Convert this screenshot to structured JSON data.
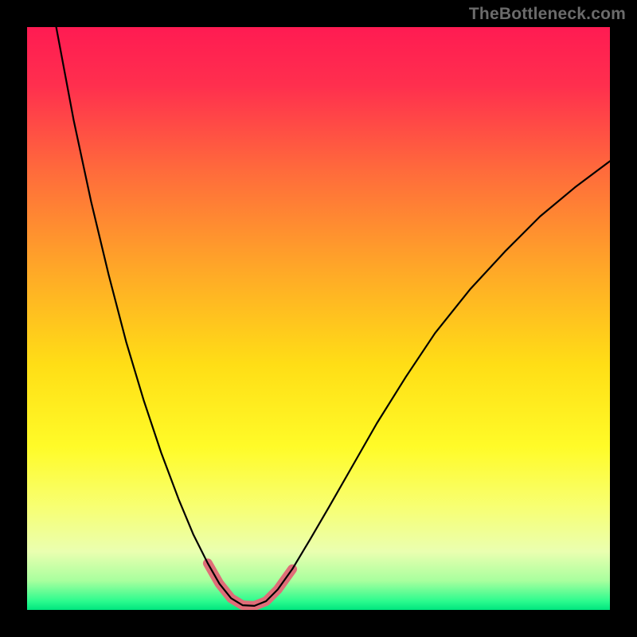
{
  "watermark": "TheBottleneck.com",
  "chart_data": {
    "type": "line",
    "title": "",
    "xlabel": "",
    "ylabel": "",
    "xlim": [
      0,
      100
    ],
    "ylim": [
      0,
      100
    ],
    "grid": false,
    "legend": false,
    "background_gradient": {
      "stops": [
        {
          "offset": 0.0,
          "color": "#ff1b52"
        },
        {
          "offset": 0.1,
          "color": "#ff2f4e"
        },
        {
          "offset": 0.25,
          "color": "#ff6c3b"
        },
        {
          "offset": 0.42,
          "color": "#ffa927"
        },
        {
          "offset": 0.58,
          "color": "#ffde16"
        },
        {
          "offset": 0.72,
          "color": "#fffb28"
        },
        {
          "offset": 0.82,
          "color": "#f8ff70"
        },
        {
          "offset": 0.9,
          "color": "#eaffb0"
        },
        {
          "offset": 0.95,
          "color": "#a8ff9e"
        },
        {
          "offset": 0.985,
          "color": "#2cfb8e"
        },
        {
          "offset": 1.0,
          "color": "#00e57e"
        }
      ]
    },
    "series": [
      {
        "name": "bottleneck-curve",
        "color": "#000000",
        "width": 2.2,
        "points": [
          {
            "x": 5.0,
            "y": 100.0
          },
          {
            "x": 8.0,
            "y": 84.0
          },
          {
            "x": 11.0,
            "y": 70.0
          },
          {
            "x": 14.0,
            "y": 57.5
          },
          {
            "x": 17.0,
            "y": 46.0
          },
          {
            "x": 20.0,
            "y": 36.0
          },
          {
            "x": 23.0,
            "y": 27.0
          },
          {
            "x": 26.0,
            "y": 19.0
          },
          {
            "x": 28.5,
            "y": 13.0
          },
          {
            "x": 31.0,
            "y": 8.0
          },
          {
            "x": 33.0,
            "y": 4.5
          },
          {
            "x": 35.0,
            "y": 2.0
          },
          {
            "x": 37.0,
            "y": 0.8
          },
          {
            "x": 39.0,
            "y": 0.7
          },
          {
            "x": 41.0,
            "y": 1.5
          },
          {
            "x": 43.0,
            "y": 3.5
          },
          {
            "x": 45.5,
            "y": 7.0
          },
          {
            "x": 48.5,
            "y": 12.0
          },
          {
            "x": 52.0,
            "y": 18.0
          },
          {
            "x": 56.0,
            "y": 25.0
          },
          {
            "x": 60.0,
            "y": 32.0
          },
          {
            "x": 65.0,
            "y": 40.0
          },
          {
            "x": 70.0,
            "y": 47.5
          },
          {
            "x": 76.0,
            "y": 55.0
          },
          {
            "x": 82.0,
            "y": 61.5
          },
          {
            "x": 88.0,
            "y": 67.5
          },
          {
            "x": 94.0,
            "y": 72.5
          },
          {
            "x": 100.0,
            "y": 77.0
          }
        ]
      },
      {
        "name": "optimal-range-highlight",
        "color": "#df6d78",
        "width": 12,
        "linecap": "round",
        "points": [
          {
            "x": 31.0,
            "y": 8.0
          },
          {
            "x": 33.0,
            "y": 4.5
          },
          {
            "x": 35.0,
            "y": 2.0
          },
          {
            "x": 37.0,
            "y": 0.8
          },
          {
            "x": 39.0,
            "y": 0.7
          },
          {
            "x": 41.0,
            "y": 1.5
          },
          {
            "x": 43.0,
            "y": 3.5
          },
          {
            "x": 45.5,
            "y": 7.0
          }
        ]
      }
    ]
  }
}
